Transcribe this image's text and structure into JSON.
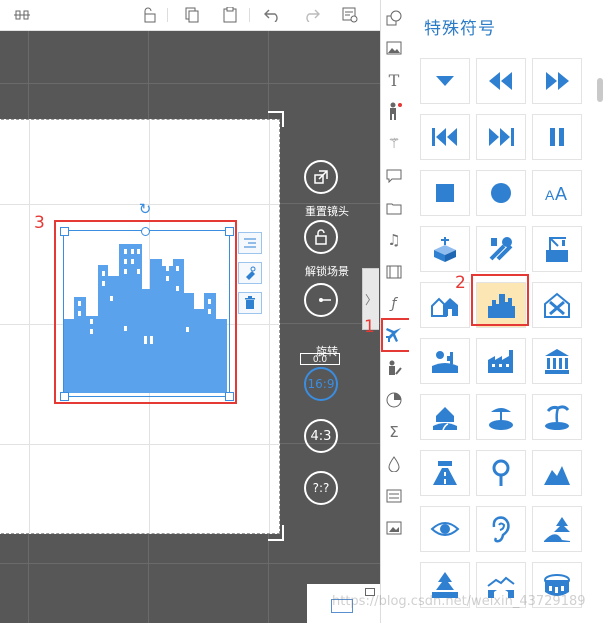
{
  "toolbar": {
    "buttons": [
      "align-icon",
      "unlock-icon",
      "copy-icon",
      "paste-icon",
      "undo-icon",
      "redo-icon",
      "preview-icon"
    ]
  },
  "camera": {
    "reset_label": "重置镜头",
    "unlock_label": "解锁场景",
    "rotate_label": "旋转",
    "rotate_value": "0.0",
    "ratio_16_9": "16:9",
    "ratio_4_3": "4:3",
    "ratio_custom": "?:?"
  },
  "annotations": {
    "num1": "1",
    "num2": "2",
    "num3": "3"
  },
  "side_icons": [
    "shape-icon",
    "image-icon",
    "text-icon",
    "character-icon",
    "effect-icon",
    "bubble-icon",
    "folder-icon",
    "music-icon",
    "video-icon",
    "formula-icon",
    "special-symbol-icon",
    "hand-draw-icon",
    "chart-icon",
    "sigma-icon",
    "drop-icon",
    "list-icon",
    "picture-icon"
  ],
  "panel": {
    "title": "特殊符号",
    "tiles": [
      {
        "name": "triangle-down-icon"
      },
      {
        "name": "rewind-icon"
      },
      {
        "name": "fast-forward-icon"
      },
      {
        "name": "skip-back-icon"
      },
      {
        "name": "skip-forward-icon"
      },
      {
        "name": "pause-icon"
      },
      {
        "name": "stop-square-icon"
      },
      {
        "name": "circle-icon"
      },
      {
        "name": "text-size-icon"
      },
      {
        "name": "iso-cube-icon"
      },
      {
        "name": "tools-icon"
      },
      {
        "name": "construction-icon"
      },
      {
        "name": "houses-icon"
      },
      {
        "name": "city-icon"
      },
      {
        "name": "disaster-house-icon"
      },
      {
        "name": "desert-icon"
      },
      {
        "name": "factory-icon"
      },
      {
        "name": "bank-icon"
      },
      {
        "name": "house-road-icon"
      },
      {
        "name": "beach-umbrella-icon"
      },
      {
        "name": "island-icon"
      },
      {
        "name": "highway-icon"
      },
      {
        "name": "location-pin-icon"
      },
      {
        "name": "mountain-icon"
      },
      {
        "name": "eye-icon"
      },
      {
        "name": "ear-icon"
      },
      {
        "name": "forest-road-icon"
      },
      {
        "name": "pine-tree-icon"
      },
      {
        "name": "bridge-icon"
      },
      {
        "name": "stadium-icon"
      }
    ]
  },
  "watermark": "https://blog.csdn.net/weixin_43729189"
}
